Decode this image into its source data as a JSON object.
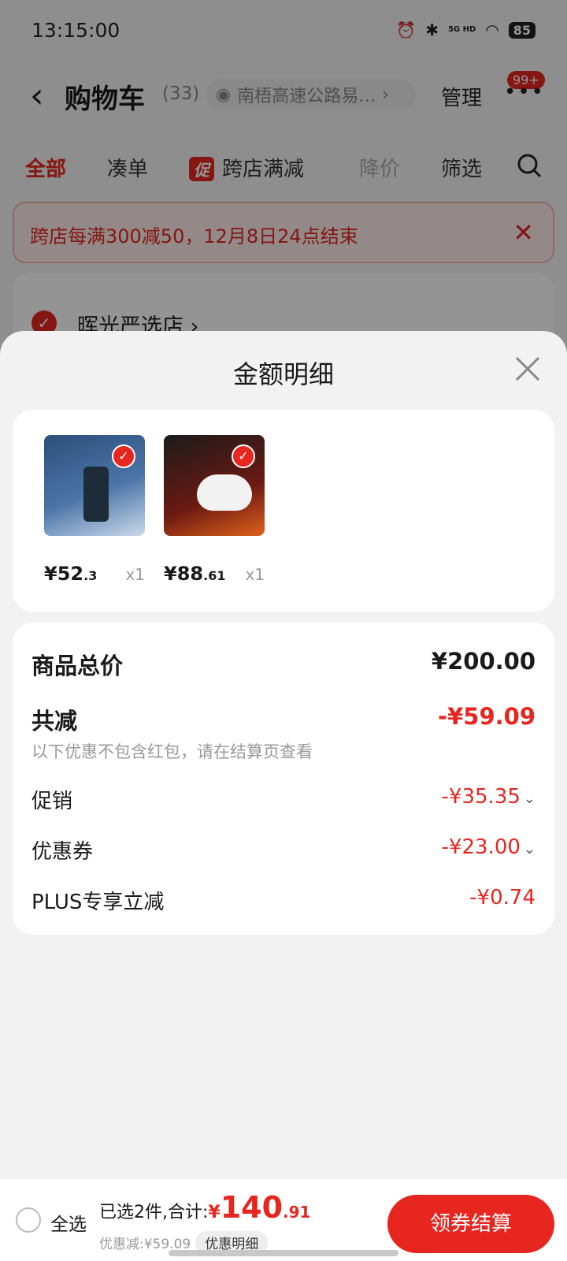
{
  "status": {
    "time": "13:15:00",
    "network": "5G HD",
    "battery": "85"
  },
  "nav": {
    "title": "购物车",
    "count": "(33)",
    "address": "南梧高速公路易…",
    "manage": "管理",
    "badge": "99+"
  },
  "tabs": {
    "all": "全部",
    "bundle": "凑单",
    "promo_tag": "促",
    "cross_store": "跨店满减",
    "price_drop": "降价",
    "filter": "筛选"
  },
  "banner": {
    "text": "跨店每满300减50，12月8日24点结束"
  },
  "store": {
    "name": "晖光严选店 ›"
  },
  "sheet": {
    "title": "金额明细",
    "items": [
      {
        "price_int": "¥52",
        "price_dec": ".3",
        "qty": "x1"
      },
      {
        "price_int": "¥88",
        "price_dec": ".61",
        "qty": "x1"
      }
    ],
    "summary": {
      "goods_total_label": "商品总价",
      "goods_total": "¥200.00",
      "total_off_label": "共减",
      "total_off": "-¥59.09",
      "note": "以下优惠不包含红包，请在结算页查看",
      "promo_label": "促销",
      "promo": "-¥35.35",
      "coupon_label": "优惠券",
      "coupon": "-¥23.00",
      "plus_label": "PLUS专享立减",
      "plus": "-¥0.74"
    }
  },
  "bottom": {
    "select_all": "全选",
    "selected_prefix": "已选2件,合计:",
    "currency": "¥",
    "total_int": "140",
    "total_dec": ".91",
    "discount": "优惠减:¥59.09",
    "detail_btn": "优惠明细",
    "checkout": "领券结算"
  },
  "colors": {
    "accent": "#e6261f"
  }
}
